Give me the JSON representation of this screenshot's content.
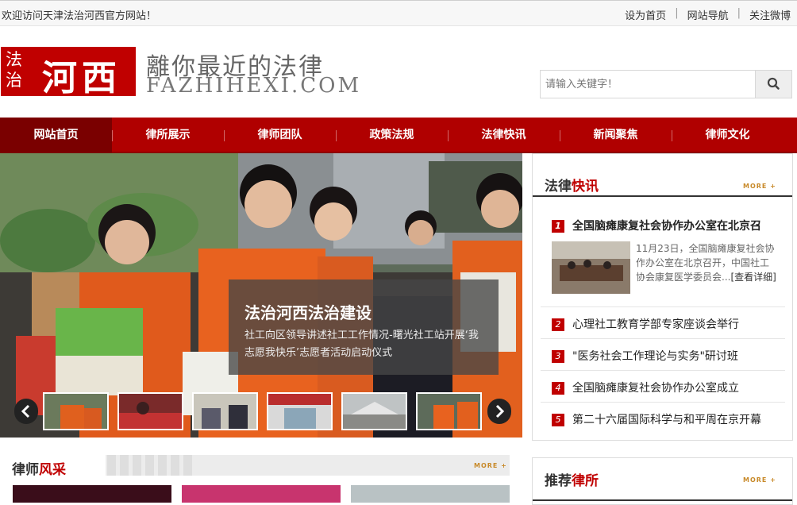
{
  "topbar": {
    "welcome": "欢迎访问天津法治河西官方网站！",
    "links": [
      "设为首页",
      "网站导航",
      "关注微博"
    ]
  },
  "header": {
    "logo_small_1": "法",
    "logo_small_2": "治",
    "logo_big": "河西",
    "slogan": "離你最近的法律",
    "domain": "FAZHIHEXI.COM",
    "search_placeholder": "请输入关键字！",
    "search_icon": "search-icon"
  },
  "nav": {
    "items": [
      "网站首页",
      "律所展示",
      "律师团队",
      "政策法规",
      "法律快讯",
      "新闻聚焦",
      "律师文化"
    ]
  },
  "banner": {
    "title": "法治河西法治建设",
    "desc": "社工向区领导讲述社工工作情况-曙光社工站开展‘我志愿我快乐’志愿者活动启动仪式",
    "prev_icon": "chevron-left-icon",
    "next_icon": "chevron-right-icon"
  },
  "law_news": {
    "title_a": "法律",
    "title_b": "快讯",
    "more": "MORE +",
    "first": {
      "num": "1",
      "title": "全国脑瘫康复社会协作办公室在北京召",
      "summary": "11月23日，全国脑瘫康复社会协作办公室在北京召开，中国社工协会康复医学委员会...",
      "detail": "[查看详细]"
    },
    "items": [
      {
        "num": "2",
        "title": "心理社工教育学部专家座谈会举行"
      },
      {
        "num": "3",
        "title": "\"医务社会工作理论与实务\"研讨班"
      },
      {
        "num": "4",
        "title": "全国脑瘫康复社会协作办公室成立"
      },
      {
        "num": "5",
        "title": "第二十六届国际科学与和平周在京开幕"
      }
    ]
  },
  "lawyer_style": {
    "title_a": "律师",
    "title_b": "风采",
    "more": "MORE +"
  },
  "recommend": {
    "title_a": "推荐",
    "title_b": "律所",
    "more": "MORE +"
  }
}
